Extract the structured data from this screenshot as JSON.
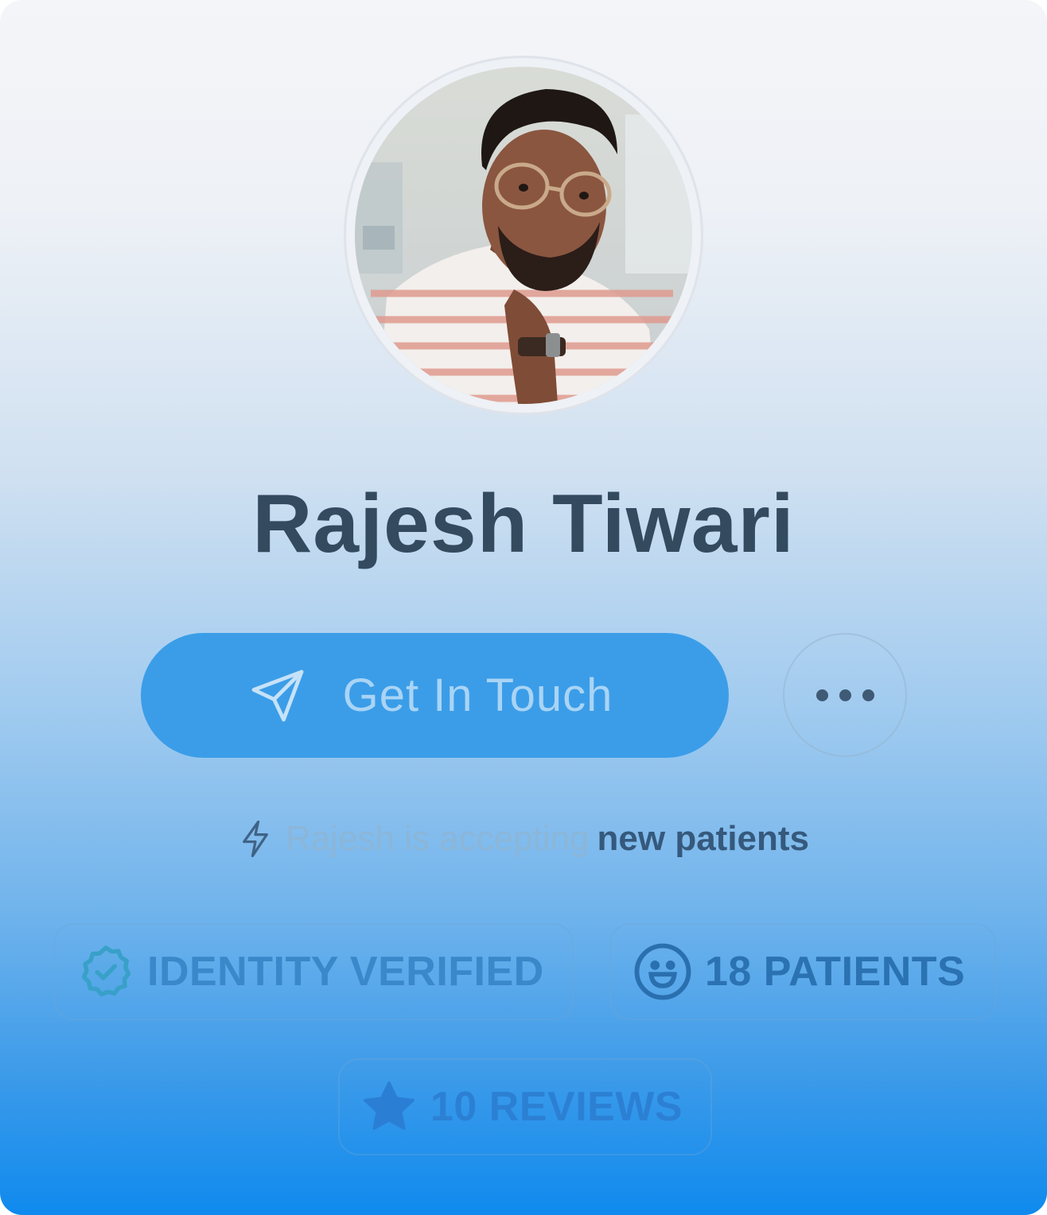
{
  "profile": {
    "name": "Rajesh Tiwari",
    "avatar_alt": "avatar-photo"
  },
  "actions": {
    "primary_label": "Get In Touch",
    "primary_icon": "paper-plane-icon",
    "more_icon": "more-horizontal-icon"
  },
  "status": {
    "icon": "lightning-icon",
    "text_prefix": "Rajesh is accepting",
    "text_emphasis": "new patients"
  },
  "badges": [
    {
      "label": "IDENTITY VERIFIED",
      "icon": "verified-badge-icon"
    },
    {
      "label": "18 PATIENTS",
      "icon": "smiley-icon"
    },
    {
      "label": "10 REVIEWS",
      "icon": "star-icon"
    }
  ],
  "colors": {
    "name_text": "#344a5e",
    "cta_bg": "#3b9de8",
    "cta_text": "#a9d4f5",
    "accent": "#0f8aee"
  }
}
